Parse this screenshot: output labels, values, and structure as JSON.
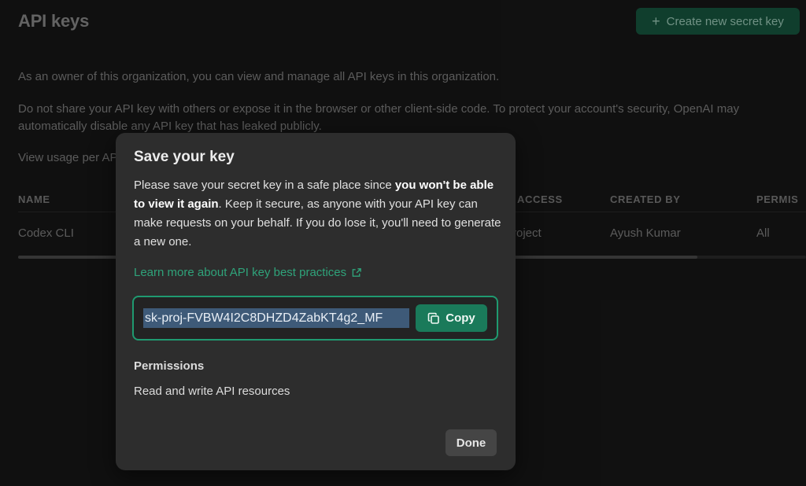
{
  "header": {
    "title": "API keys",
    "create_button_label": "Create new secret key"
  },
  "description": {
    "line1": "As an owner of this organization, you can view and manage all API keys in this organization.",
    "line2": "Do not share your API key with others or expose it in the browser or other client-side code. To protect your account's security, OpenAI may automatically disable any API key that has leaked publicly.",
    "line3": "View usage per AP"
  },
  "table": {
    "columns": [
      "NAME",
      "ACCESS",
      "CREATED BY",
      "PERMIS"
    ],
    "rows": [
      {
        "name": "Codex CLI",
        "access": "roject",
        "created_by": "Ayush Kumar",
        "permissions": "All"
      }
    ]
  },
  "modal": {
    "title": "Save your key",
    "text_before": "Please save your secret key in a safe place since ",
    "text_bold": "you won't be able to view it again",
    "text_after": ". Keep it secure, as anyone with your API key can make requests on your behalf. If you do lose it, you'll need to generate a new one.",
    "learn_link": "Learn more about API key best practices",
    "key_value": "sk-proj-FVBW4I2C8DHZD4ZabKT4g2_MF",
    "copy_label": "Copy",
    "permissions_title": "Permissions",
    "permissions_value": "Read and write API resources",
    "done_label": "Done"
  },
  "colors": {
    "accent_green": "#1a7a5a",
    "link_green": "#2fa37a",
    "modal_bg": "#2d2d2d",
    "page_bg": "#171717"
  }
}
